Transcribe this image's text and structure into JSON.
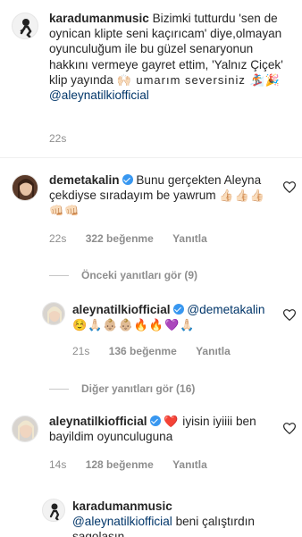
{
  "post_caption": {
    "username": "karadumanmusic",
    "text": "Bizimki tutturdu 'sen de oynican klipte seni kaçırıcam' diye,olmayan oyunculuğum ile bu güzel senaryonun hakkını vermeye gayret ettim, 'Yalnız Çiçek' klip yayında",
    "emojis": "🙌🏻 umarım seversiniz 🏂🎉",
    "mention": "@aleynatilkiofficial",
    "time": "22s"
  },
  "comment1": {
    "username": "demetakalin",
    "verified": true,
    "text": "Bunu gerçekten Aleyna çekdiyse sıradayım be yawrum",
    "emojis": "👍🏻👍🏻👍🏻 👊🏻👊🏻",
    "time": "22s",
    "likes": "322 beğenme",
    "reply": "Yanıtla"
  },
  "view_previous": "Önceki yanıtları gör (9)",
  "reply1": {
    "username": "aleynatilkiofficial",
    "verified": true,
    "mention": "@demetakalin",
    "emojis": "☺️🙏🏻👶🏼👶🏼🔥🔥💜🙏🏻",
    "time": "21s",
    "likes": "136 beğenme",
    "reply": "Yanıtla"
  },
  "view_other": "Diğer yanıtları gör (16)",
  "comment2": {
    "username": "aleynatilkiofficial",
    "verified": true,
    "heart_emoji": "❤️",
    "text": "iyisin iyiiii ben bayildim oyunculuguna",
    "time": "14s",
    "likes": "128 beğenme",
    "reply": "Yanıtla"
  },
  "reply2": {
    "username": "karadumanmusic",
    "mention": "@aleynatilkiofficial",
    "text": "beni çalıştırdın sagolasın ..."
  }
}
